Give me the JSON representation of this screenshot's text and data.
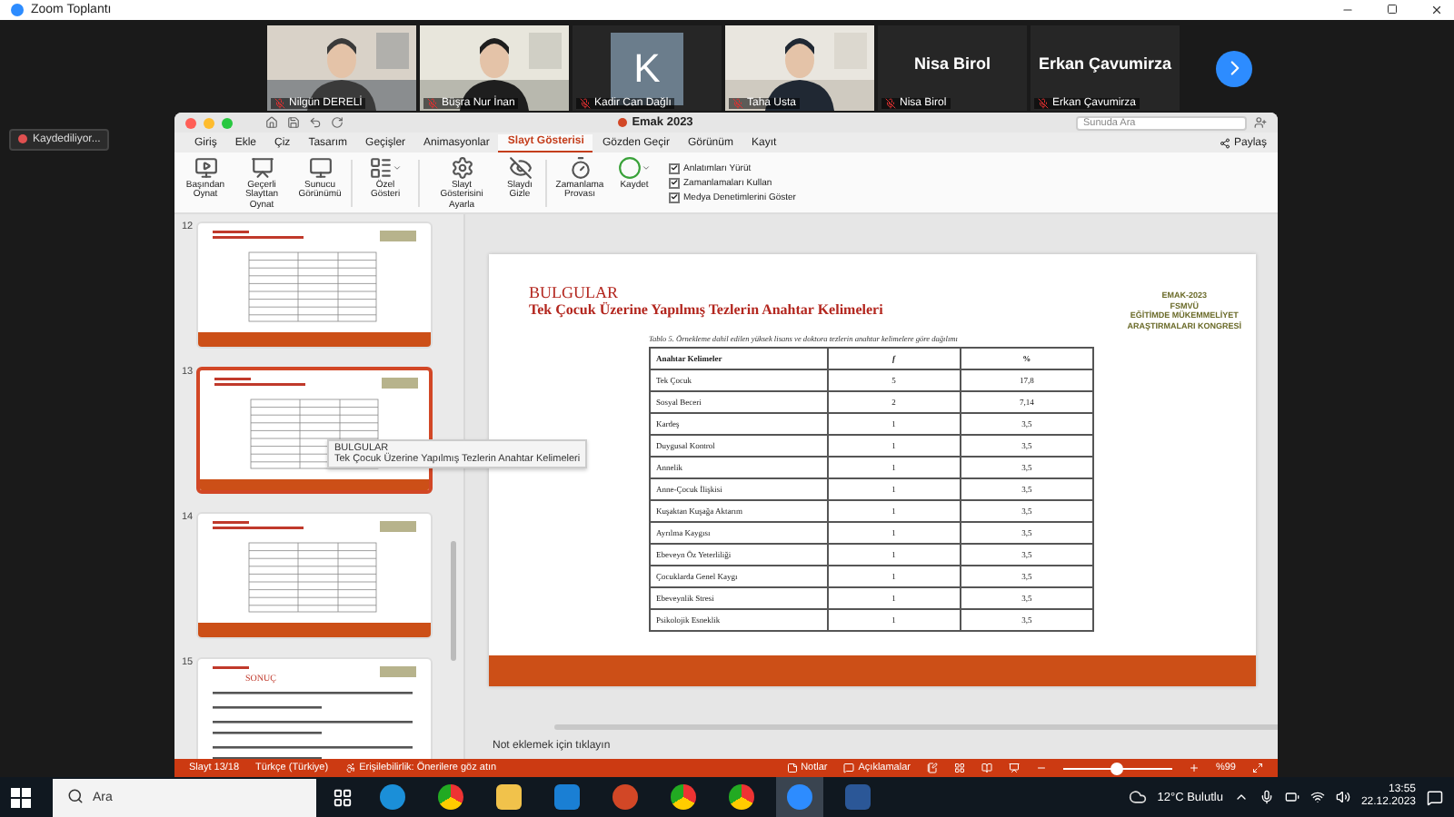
{
  "zoom_window": {
    "title": "Zoom Toplantı"
  },
  "participants": [
    {
      "kind": "video",
      "name": "Nilgün DERELİ",
      "muted": true
    },
    {
      "kind": "video",
      "name": "Büşra Nur İnan",
      "muted": true
    },
    {
      "kind": "avatar",
      "initial": "K",
      "name": "Kadir Can Dağlı",
      "muted": true
    },
    {
      "kind": "video",
      "name": "Taha Usta",
      "muted": true
    },
    {
      "kind": "name",
      "display_name": "Nisa Birol",
      "name": "Nisa Birol",
      "muted": true
    },
    {
      "kind": "name",
      "display_name": "Erkan Çavumirza",
      "name": "Erkan Çavumirza",
      "muted": true
    }
  ],
  "recording_badge": "Kaydediliyor...",
  "powerpoint": {
    "title": "Emak 2023",
    "search": {
      "placeholder": "Sunuda Ara"
    },
    "tabs": [
      {
        "label": "Giriş",
        "selected": false
      },
      {
        "label": "Ekle",
        "selected": false
      },
      {
        "label": "Çiz",
        "selected": false
      },
      {
        "label": "Tasarım",
        "selected": false
      },
      {
        "label": "Geçişler",
        "selected": false
      },
      {
        "label": "Animasyonlar",
        "selected": false
      },
      {
        "label": "Slayt Gösterisi",
        "selected": true
      },
      {
        "label": "Gözden Geçir",
        "selected": false
      },
      {
        "label": "Görünüm",
        "selected": false
      },
      {
        "label": "Kayıt",
        "selected": false
      }
    ],
    "share": "Paylaş",
    "ribbon": [
      {
        "label": "Başından Oynat",
        "dropdown": false
      },
      {
        "label": "Geçerli Slayttan Oynat",
        "dropdown": false
      },
      {
        "label": "Sunucu Görünümü",
        "dropdown": false
      },
      {
        "label": "Özel Gösteri",
        "dropdown": true
      },
      {
        "label": "Slayt Gösterisini Ayarla",
        "dropdown": false
      },
      {
        "label": "Slaydı Gizle",
        "dropdown": false
      },
      {
        "label": "Zamanlama Provası",
        "dropdown": false
      },
      {
        "label": "Kaydet",
        "dropdown": true
      }
    ],
    "options": [
      {
        "label": "Anlatımları Yürüt",
        "checked": true
      },
      {
        "label": "Zamanlamaları Kullan",
        "checked": true
      },
      {
        "label": "Medya Denetimlerini Göster",
        "checked": true
      }
    ],
    "thumbnails": [
      {
        "number": "12",
        "kind": "table",
        "selected": false
      },
      {
        "number": "13",
        "kind": "table",
        "selected": true
      },
      {
        "number": "14",
        "kind": "table",
        "selected": false
      },
      {
        "number": "15",
        "kind": "text",
        "title": "SONUÇ",
        "selected": false
      }
    ],
    "tooltip": {
      "lines": [
        "BULGULAR",
        "Tek Çocuk Üzerine Yapılmış Tezlerin Anahtar Kelimeleri"
      ]
    },
    "slide": {
      "heading": "BULGULAR",
      "title": "Tek Çocuk Üzerine Yapılmış Tezlerin Anahtar Kelimeleri",
      "logo": [
        "EMAK-2023",
        "FSMVÜ",
        "EĞİTİMDE MÜKEMMELİYET",
        "ARAŞTIRMALARI KONGRESİ"
      ],
      "caption": "Tablo 5. Örnekleme dahil edilen yüksek lisans ve doktora tezlerin anahtar kelimelere göre dağılımı",
      "table": {
        "columns": [
          "Anahtar Kelimeler",
          "f",
          "%"
        ],
        "rows": [
          [
            "Tek Çocuk",
            "5",
            "17,8"
          ],
          [
            "Sosyal Beceri",
            "2",
            "7,14"
          ],
          [
            "Kardeş",
            "1",
            "3,5"
          ],
          [
            "Duygusal Kontrol",
            "1",
            "3,5"
          ],
          [
            "Annelik",
            "1",
            "3,5"
          ],
          [
            "Anne-Çocuk İlişkisi",
            "1",
            "3,5"
          ],
          [
            "Kuşaktan Kuşağa Aktarım",
            "1",
            "3,5"
          ],
          [
            "Ayrılma Kaygısı",
            "1",
            "3,5"
          ],
          [
            "Ebeveyn Öz Yeterliliği",
            "1",
            "3,5"
          ],
          [
            "Çocuklarda Genel Kaygı",
            "1",
            "3,5"
          ],
          [
            "Ebeveynlik Stresi",
            "1",
            "3,5"
          ],
          [
            "Psikolojik Esneklik",
            "1",
            "3,5"
          ]
        ]
      }
    },
    "notes": {
      "placeholder": "Not eklemek için tıklayın"
    },
    "status_bar": {
      "slide": "Slayt 13/18",
      "language": "Türkçe (Türkiye)",
      "accessibility": "Erişilebilirlik: Önerilere göz atın",
      "notes": "Notlar",
      "comments": "Açıklamalar",
      "zoom": {
        "level": 0.5
      },
      "zoom_reading": "%99"
    }
  },
  "taskbar": {
    "search": {
      "placeholder": "Ara"
    },
    "weather": "12°C Bulutlu",
    "time": "13:55",
    "date": "22.12.2023"
  }
}
